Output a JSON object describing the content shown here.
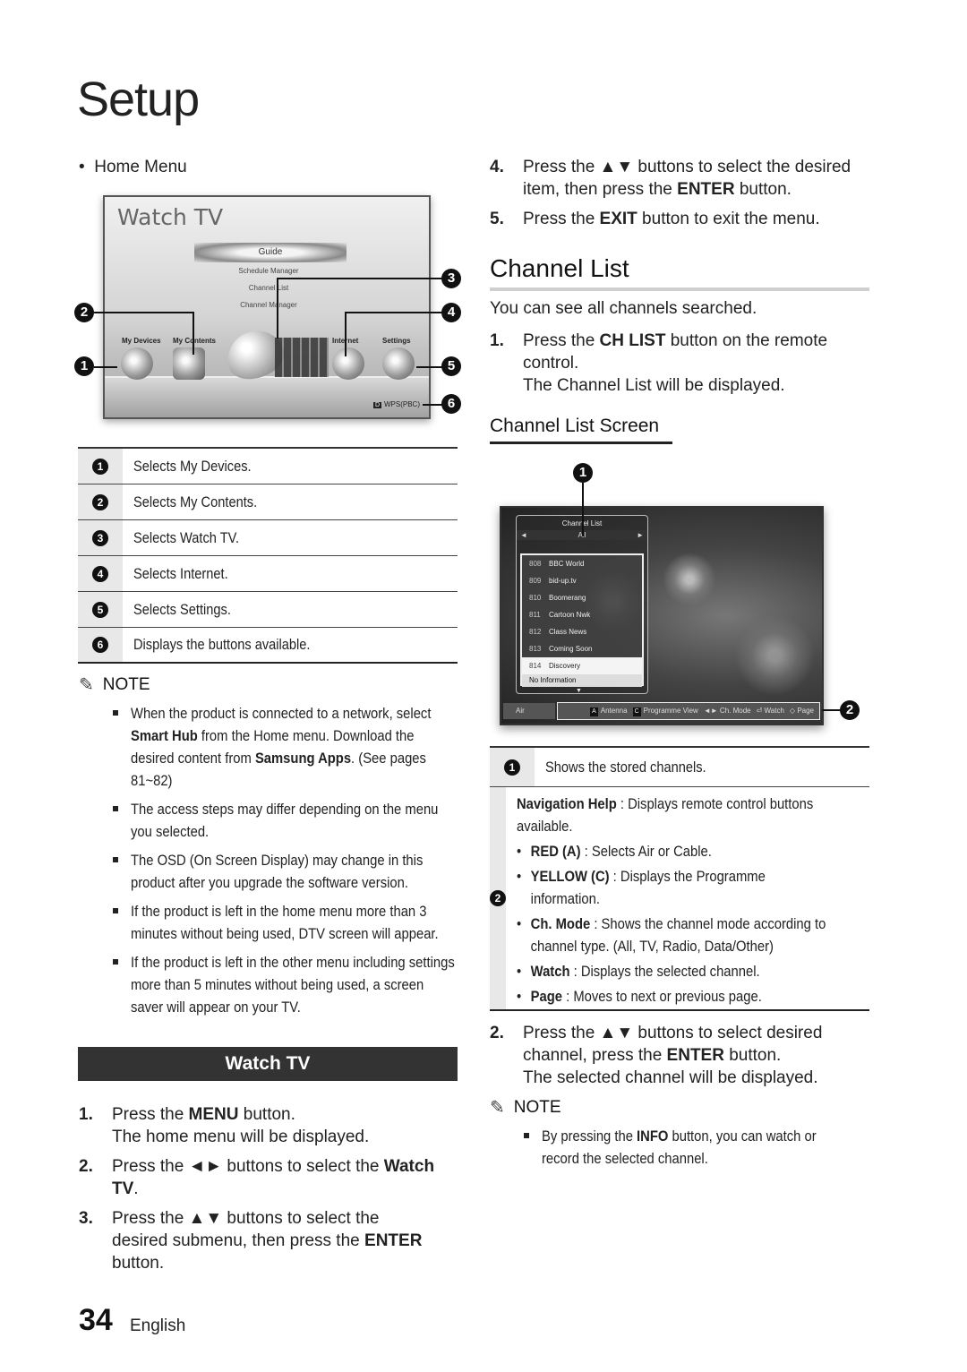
{
  "page": {
    "title": "Setup",
    "number": "34",
    "language": "English"
  },
  "left": {
    "home_menu_label": "Home Menu",
    "home_screen": {
      "title": "Watch TV",
      "guide": "Guide",
      "submenu": [
        "Schedule Manager",
        "Channel List",
        "Channel Manager"
      ],
      "items": [
        "My Devices",
        "My Contents",
        "Internet",
        "Settings"
      ],
      "button_key": "D",
      "button_label": "WPS(PBC)"
    },
    "callouts": [
      "1",
      "2",
      "3",
      "4",
      "5",
      "6"
    ],
    "legend": [
      {
        "num": "1",
        "text": "Selects My Devices."
      },
      {
        "num": "2",
        "text": "Selects My Contents."
      },
      {
        "num": "3",
        "text": "Selects Watch TV."
      },
      {
        "num": "4",
        "text": "Selects Internet."
      },
      {
        "num": "5",
        "text": "Selects Settings."
      },
      {
        "num": "6",
        "text": "Displays the buttons available."
      }
    ],
    "note": {
      "header": "NOTE",
      "items": [
        {
          "pre": "When the product is connected to a network, select ",
          "b1": "Smart Hub",
          "mid": " from the Home menu. Download the desired content from ",
          "b2": "Samsung Apps",
          "post": ". (See pages 81~82)"
        },
        {
          "text": "The access steps may differ depending on the menu you selected."
        },
        {
          "text": "The OSD (On Screen Display) may change in this product after you upgrade the software version."
        },
        {
          "text": "If the product is left in the home menu more than 3 minutes without being used, DTV screen will appear."
        },
        {
          "text": "If the product is left in the other menu including settings more than 5 minutes without being used, a screen saver will appear on your TV."
        }
      ]
    },
    "watch_tv": {
      "heading": "Watch TV",
      "steps": [
        {
          "n": "1.",
          "pre": "Press the ",
          "b": "MENU",
          "post": " button.",
          "sub": "The home menu will be displayed."
        },
        {
          "n": "2.",
          "pre": "Press the ◄► buttons to select the ",
          "b": "Watch TV",
          "post": "."
        },
        {
          "n": "3.",
          "pre": "Press the ▲▼ buttons to select the desired submenu, then press the ",
          "b": "ENTER",
          "post": " button."
        }
      ]
    }
  },
  "right": {
    "steps_top": [
      {
        "n": "4.",
        "pre": "Press the ▲▼ buttons to select the desired item, then press the ",
        "b": "ENTER",
        "post": " button."
      },
      {
        "n": "5.",
        "pre": "Press the ",
        "b": "EXIT",
        "post": " button to exit the menu."
      }
    ],
    "channel_list": {
      "heading": "Channel List",
      "intro": "You can see all channels searched.",
      "step1": {
        "n": "1.",
        "pre": "Press the ",
        "b": "CH LIST",
        "post": " button on the remote control.",
        "sub": "The Channel List will be displayed."
      },
      "screen_heading": "Channel List Screen",
      "screen": {
        "title": "Channel List",
        "mode": "All",
        "channels": [
          {
            "num": "808",
            "name": "BBC World"
          },
          {
            "num": "809",
            "name": "bid-up.tv"
          },
          {
            "num": "810",
            "name": "Boomerang"
          },
          {
            "num": "811",
            "name": "Cartoon Nwk"
          },
          {
            "num": "812",
            "name": "Class News"
          },
          {
            "num": "813",
            "name": "Coming Soon"
          },
          {
            "num": "814",
            "name": "Discovery"
          }
        ],
        "selected_index": 6,
        "info": "No Information",
        "source": "Air",
        "help": [
          {
            "key": "A",
            "label": "Antenna"
          },
          {
            "key": "C",
            "label": "Programme View"
          },
          {
            "key": "◄►",
            "label": "Ch. Mode"
          },
          {
            "key": "⏎",
            "label": "Watch"
          },
          {
            "key": "◇",
            "label": "Page"
          }
        ]
      },
      "legend": {
        "row1": {
          "num": "1",
          "text": "Shows the stored channels."
        },
        "row2": {
          "num": "2",
          "intro_b": "Navigation Help",
          "intro": " : Displays remote control buttons available.",
          "bullets": [
            {
              "b": "RED (A)",
              "t": " : Selects Air or Cable."
            },
            {
              "b": "YELLOW (C)",
              "t": " : Displays the Programme information."
            },
            {
              "b": "Ch. Mode",
              "t": " : Shows the channel mode according to channel type. (All, TV, Radio, Data/Other)"
            },
            {
              "b": "Watch",
              "t": " : Displays the selected channel."
            },
            {
              "b": "Page",
              "t": " : Moves to next or previous page."
            }
          ]
        }
      },
      "step2": {
        "n": "2.",
        "pre": "Press the ▲▼ buttons to select desired channel, press the ",
        "b": "ENTER",
        "post": " button.",
        "sub": "The selected channel will be displayed."
      },
      "note": {
        "header": "NOTE",
        "pre": "By pressing the ",
        "b": "INFO",
        "post": " button, you can watch or record the selected channel."
      }
    }
  }
}
